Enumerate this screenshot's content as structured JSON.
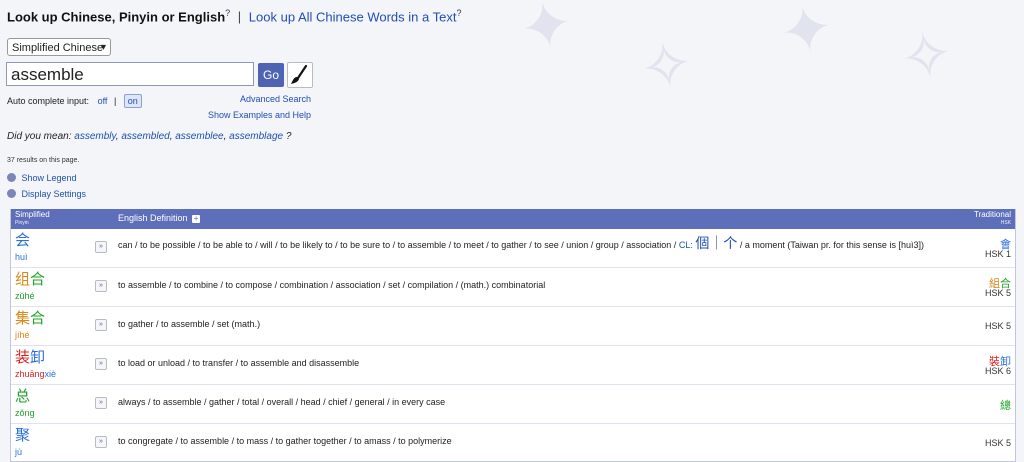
{
  "header": {
    "lookup_label": "Look up Chinese, Pinyin or English",
    "help_mark": "?",
    "separator": "|",
    "lookup_all_link": "Look up All Chinese Words in a Text",
    "help_mark2": "?"
  },
  "search": {
    "script_select": "Simplified Chinese",
    "query": "assemble",
    "go_label": "Go",
    "autocomplete_label": "Auto complete input:",
    "off_label": "off",
    "pipe": "|",
    "on_label": "on",
    "advanced_search": "Advanced Search",
    "show_examples": "Show Examples and Help"
  },
  "did_you_mean": {
    "label": "Did you mean:",
    "suggestions": [
      "assembly",
      "assembled",
      "assemblee",
      "assemblage"
    ],
    "end": "?"
  },
  "results": {
    "count_text": "37 results on this page.",
    "show_legend": "Show Legend",
    "display_settings": "Display Settings"
  },
  "table": {
    "header": {
      "simplified": "Simplified",
      "pinyin_small": "Pinyin",
      "english_definition": "English Definition",
      "plus": "+",
      "traditional": "Traditional",
      "hsk_small": "HSK"
    },
    "rows": [
      {
        "chars": "会",
        "pinyin": "huì",
        "definition_pre": "can / to be possible / to be able to / will / to be likely to / to be sure to / to assemble / to meet / to gather / to see / union / group / association /",
        "cl_label": "CL:",
        "cl_chars": "個｜个",
        "definition_post": "/ a moment (Taiwan pr. for this sense is [huì3])",
        "traditional": "會",
        "hsk": "HSK 1",
        "tone_class": "t1"
      },
      {
        "chars": "组合",
        "pinyin": "zǔhé",
        "definition": "to assemble / to combine / to compose / combination / association / set / compilation / (math.) combinatorial",
        "traditional": "組合",
        "hsk": "HSK 5"
      },
      {
        "chars": "集合",
        "pinyin": "jíhé",
        "definition": "to gather / to assemble / set (math.)",
        "traditional": "",
        "hsk": "HSK 5"
      },
      {
        "chars": "装卸",
        "pinyin": "zhuāngxiè",
        "definition": "to load or unload / to transfer / to assemble and disassemble",
        "traditional": "裝卸",
        "hsk": "HSK 6"
      },
      {
        "chars": "总",
        "pinyin": "zǒng",
        "definition": "always / to assemble / gather / total / overall / head / chief / general / in every case",
        "traditional": "總",
        "hsk": ""
      },
      {
        "chars": "聚",
        "pinyin": "jù",
        "definition": "to congregate / to assemble / to mass / to gather together / to amass / to polymerize",
        "traditional": "",
        "hsk": "HSK 5"
      }
    ]
  }
}
